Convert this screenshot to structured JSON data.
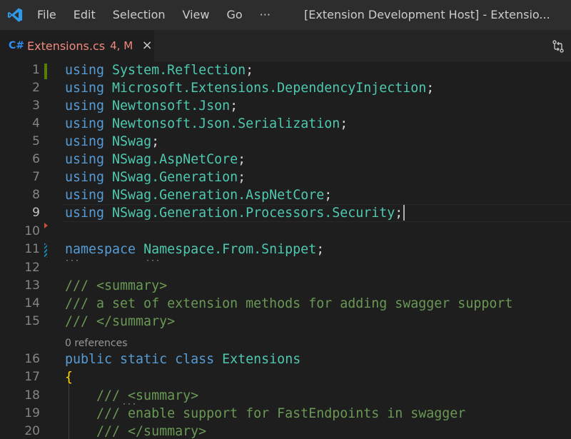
{
  "titlebar": {
    "menu": [
      "File",
      "Edit",
      "Selection",
      "View",
      "Go",
      "···"
    ],
    "window_title": "[Extension Development Host] - Extensio..."
  },
  "tab": {
    "language_icon": "C#",
    "filename": "Extensions.cs",
    "badge": "4, M",
    "close_icon": "×"
  },
  "editor": {
    "lines": [
      {
        "n": "1",
        "tokens": [
          {
            "t": "using ",
            "c": "kw"
          },
          {
            "t": "System.Reflection",
            "c": "ns"
          },
          {
            "t": ";",
            "c": "plain"
          }
        ]
      },
      {
        "n": "2",
        "tokens": [
          {
            "t": "using ",
            "c": "kw"
          },
          {
            "t": "Microsoft.Extensions.DependencyInjection",
            "c": "ns"
          },
          {
            "t": ";",
            "c": "plain"
          }
        ]
      },
      {
        "n": "3",
        "tokens": [
          {
            "t": "using ",
            "c": "kw"
          },
          {
            "t": "Newtonsoft.Json",
            "c": "ns"
          },
          {
            "t": ";",
            "c": "plain"
          }
        ]
      },
      {
        "n": "4",
        "tokens": [
          {
            "t": "using ",
            "c": "kw"
          },
          {
            "t": "Newtonsoft.Json.Serialization",
            "c": "ns"
          },
          {
            "t": ";",
            "c": "plain"
          }
        ]
      },
      {
        "n": "5",
        "tokens": [
          {
            "t": "using ",
            "c": "kw"
          },
          {
            "t": "NSwag",
            "c": "ns"
          },
          {
            "t": ";",
            "c": "plain"
          }
        ]
      },
      {
        "n": "6",
        "tokens": [
          {
            "t": "using ",
            "c": "kw"
          },
          {
            "t": "NSwag.AspNetCore",
            "c": "ns"
          },
          {
            "t": ";",
            "c": "plain"
          }
        ]
      },
      {
        "n": "7",
        "tokens": [
          {
            "t": "using ",
            "c": "kw"
          },
          {
            "t": "NSwag.Generation",
            "c": "ns"
          },
          {
            "t": ";",
            "c": "plain"
          }
        ]
      },
      {
        "n": "8",
        "tokens": [
          {
            "t": "using ",
            "c": "kw"
          },
          {
            "t": "NSwag.Generation.AspNetCore",
            "c": "ns"
          },
          {
            "t": ";",
            "c": "plain"
          }
        ]
      },
      {
        "n": "9",
        "tokens": [
          {
            "t": "using ",
            "c": "kw"
          },
          {
            "t": "NSwag.Generation.Processors.Security",
            "c": "ns"
          },
          {
            "t": ";",
            "c": "plain"
          }
        ]
      },
      {
        "n": "10",
        "tokens": []
      },
      {
        "n": "11",
        "tokens": [
          {
            "t": "namespace ",
            "c": "kw"
          },
          {
            "t": "Namespace.From.Snippet",
            "c": "ns"
          },
          {
            "t": ";",
            "c": "plain"
          }
        ]
      },
      {
        "n": "12",
        "tokens": []
      },
      {
        "n": "13",
        "tokens": [
          {
            "t": "/// <summary>",
            "c": "cm"
          }
        ]
      },
      {
        "n": "14",
        "tokens": [
          {
            "t": "/// a set of extension methods for adding swagger support",
            "c": "cm"
          }
        ]
      },
      {
        "n": "15",
        "tokens": [
          {
            "t": "/// </summary>",
            "c": "cm"
          }
        ]
      },
      {
        "n": "16",
        "tokens": [
          {
            "t": "public ",
            "c": "kw"
          },
          {
            "t": "static ",
            "c": "kw"
          },
          {
            "t": "class ",
            "c": "kw"
          },
          {
            "t": "Extensions",
            "c": "ns"
          }
        ]
      },
      {
        "n": "17",
        "tokens": [
          {
            "t": "{",
            "c": "brace"
          }
        ]
      },
      {
        "n": "18",
        "tokens": [
          {
            "t": "    /// <summary>",
            "c": "cm"
          }
        ]
      },
      {
        "n": "19",
        "tokens": [
          {
            "t": "    /// enable support for FastEndpoints in swagger",
            "c": "cm"
          }
        ]
      },
      {
        "n": "20",
        "tokens": [
          {
            "t": "    /// </summary>",
            "c": "cm"
          }
        ]
      }
    ],
    "codelens": "0 references",
    "active_line": "9"
  }
}
